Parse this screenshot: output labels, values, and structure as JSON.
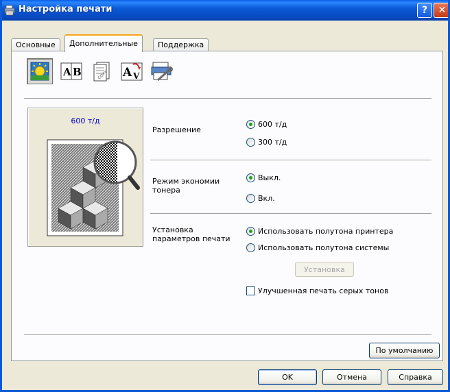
{
  "window": {
    "title": "Настройка печати",
    "help_label": "?",
    "close_label": "✕"
  },
  "tabs": [
    {
      "label": "Основные"
    },
    {
      "label": "Дополнительные"
    },
    {
      "label": "Поддержка"
    }
  ],
  "preview": {
    "label": "600 т/д"
  },
  "resolution": {
    "label": "Разрешение",
    "options": [
      "600 т/д",
      "300 т/д"
    ],
    "selected": "600 т/д"
  },
  "toner_save": {
    "label_line1": "Режим экономии",
    "label_line2": "тонера",
    "options": [
      "Выкл.",
      "Вкл."
    ],
    "selected": "Выкл."
  },
  "print_settings": {
    "label_line1": "Установка",
    "label_line2": "параметров печати",
    "options": [
      "Использовать полутона принтера",
      "Использовать полутона системы"
    ],
    "selected": "Использовать полутона принтера",
    "setup_button": "Установка",
    "gray_checkbox": "Улучшенная печать серых тонов",
    "gray_checked": false
  },
  "buttons": {
    "defaults": "По умолчанию",
    "ok": "OK",
    "cancel": "Отмена",
    "help": "Справка"
  },
  "icons": [
    "printer-icon",
    "quality-icon",
    "watermark-ab-icon",
    "copy-icon",
    "font-icon",
    "device-options-icon"
  ]
}
